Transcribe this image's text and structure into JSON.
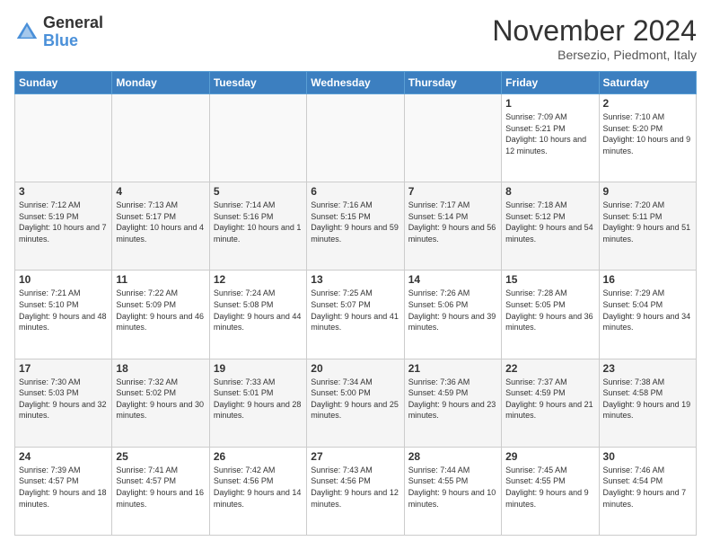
{
  "header": {
    "logo_line1": "General",
    "logo_line2": "Blue",
    "month": "November 2024",
    "location": "Bersezio, Piedmont, Italy"
  },
  "weekdays": [
    "Sunday",
    "Monday",
    "Tuesday",
    "Wednesday",
    "Thursday",
    "Friday",
    "Saturday"
  ],
  "weeks": [
    [
      {
        "day": "",
        "info": ""
      },
      {
        "day": "",
        "info": ""
      },
      {
        "day": "",
        "info": ""
      },
      {
        "day": "",
        "info": ""
      },
      {
        "day": "",
        "info": ""
      },
      {
        "day": "1",
        "info": "Sunrise: 7:09 AM\nSunset: 5:21 PM\nDaylight: 10 hours and 12 minutes."
      },
      {
        "day": "2",
        "info": "Sunrise: 7:10 AM\nSunset: 5:20 PM\nDaylight: 10 hours and 9 minutes."
      }
    ],
    [
      {
        "day": "3",
        "info": "Sunrise: 7:12 AM\nSunset: 5:19 PM\nDaylight: 10 hours and 7 minutes."
      },
      {
        "day": "4",
        "info": "Sunrise: 7:13 AM\nSunset: 5:17 PM\nDaylight: 10 hours and 4 minutes."
      },
      {
        "day": "5",
        "info": "Sunrise: 7:14 AM\nSunset: 5:16 PM\nDaylight: 10 hours and 1 minute."
      },
      {
        "day": "6",
        "info": "Sunrise: 7:16 AM\nSunset: 5:15 PM\nDaylight: 9 hours and 59 minutes."
      },
      {
        "day": "7",
        "info": "Sunrise: 7:17 AM\nSunset: 5:14 PM\nDaylight: 9 hours and 56 minutes."
      },
      {
        "day": "8",
        "info": "Sunrise: 7:18 AM\nSunset: 5:12 PM\nDaylight: 9 hours and 54 minutes."
      },
      {
        "day": "9",
        "info": "Sunrise: 7:20 AM\nSunset: 5:11 PM\nDaylight: 9 hours and 51 minutes."
      }
    ],
    [
      {
        "day": "10",
        "info": "Sunrise: 7:21 AM\nSunset: 5:10 PM\nDaylight: 9 hours and 48 minutes."
      },
      {
        "day": "11",
        "info": "Sunrise: 7:22 AM\nSunset: 5:09 PM\nDaylight: 9 hours and 46 minutes."
      },
      {
        "day": "12",
        "info": "Sunrise: 7:24 AM\nSunset: 5:08 PM\nDaylight: 9 hours and 44 minutes."
      },
      {
        "day": "13",
        "info": "Sunrise: 7:25 AM\nSunset: 5:07 PM\nDaylight: 9 hours and 41 minutes."
      },
      {
        "day": "14",
        "info": "Sunrise: 7:26 AM\nSunset: 5:06 PM\nDaylight: 9 hours and 39 minutes."
      },
      {
        "day": "15",
        "info": "Sunrise: 7:28 AM\nSunset: 5:05 PM\nDaylight: 9 hours and 36 minutes."
      },
      {
        "day": "16",
        "info": "Sunrise: 7:29 AM\nSunset: 5:04 PM\nDaylight: 9 hours and 34 minutes."
      }
    ],
    [
      {
        "day": "17",
        "info": "Sunrise: 7:30 AM\nSunset: 5:03 PM\nDaylight: 9 hours and 32 minutes."
      },
      {
        "day": "18",
        "info": "Sunrise: 7:32 AM\nSunset: 5:02 PM\nDaylight: 9 hours and 30 minutes."
      },
      {
        "day": "19",
        "info": "Sunrise: 7:33 AM\nSunset: 5:01 PM\nDaylight: 9 hours and 28 minutes."
      },
      {
        "day": "20",
        "info": "Sunrise: 7:34 AM\nSunset: 5:00 PM\nDaylight: 9 hours and 25 minutes."
      },
      {
        "day": "21",
        "info": "Sunrise: 7:36 AM\nSunset: 4:59 PM\nDaylight: 9 hours and 23 minutes."
      },
      {
        "day": "22",
        "info": "Sunrise: 7:37 AM\nSunset: 4:59 PM\nDaylight: 9 hours and 21 minutes."
      },
      {
        "day": "23",
        "info": "Sunrise: 7:38 AM\nSunset: 4:58 PM\nDaylight: 9 hours and 19 minutes."
      }
    ],
    [
      {
        "day": "24",
        "info": "Sunrise: 7:39 AM\nSunset: 4:57 PM\nDaylight: 9 hours and 18 minutes."
      },
      {
        "day": "25",
        "info": "Sunrise: 7:41 AM\nSunset: 4:57 PM\nDaylight: 9 hours and 16 minutes."
      },
      {
        "day": "26",
        "info": "Sunrise: 7:42 AM\nSunset: 4:56 PM\nDaylight: 9 hours and 14 minutes."
      },
      {
        "day": "27",
        "info": "Sunrise: 7:43 AM\nSunset: 4:56 PM\nDaylight: 9 hours and 12 minutes."
      },
      {
        "day": "28",
        "info": "Sunrise: 7:44 AM\nSunset: 4:55 PM\nDaylight: 9 hours and 10 minutes."
      },
      {
        "day": "29",
        "info": "Sunrise: 7:45 AM\nSunset: 4:55 PM\nDaylight: 9 hours and 9 minutes."
      },
      {
        "day": "30",
        "info": "Sunrise: 7:46 AM\nSunset: 4:54 PM\nDaylight: 9 hours and 7 minutes."
      }
    ]
  ]
}
